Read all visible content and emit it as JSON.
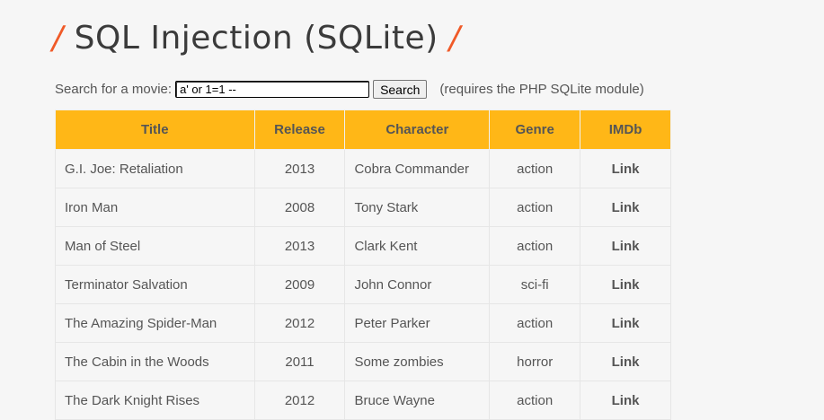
{
  "page": {
    "title": "SQL Injection (SQLite)",
    "slash": "/"
  },
  "search": {
    "label": "Search for a movie:",
    "value": "a' or 1=1 --",
    "button": "Search",
    "note": "(requires the PHP SQLite module)"
  },
  "table": {
    "headers": [
      "Title",
      "Release",
      "Character",
      "Genre",
      "IMDb"
    ],
    "rows": [
      {
        "title": "G.I. Joe: Retaliation",
        "release": "2013",
        "character": "Cobra Commander",
        "genre": "action",
        "imdb": "Link"
      },
      {
        "title": "Iron Man",
        "release": "2008",
        "character": "Tony Stark",
        "genre": "action",
        "imdb": "Link"
      },
      {
        "title": "Man of Steel",
        "release": "2013",
        "character": "Clark Kent",
        "genre": "action",
        "imdb": "Link"
      },
      {
        "title": "Terminator Salvation",
        "release": "2009",
        "character": "John Connor",
        "genre": "sci-fi",
        "imdb": "Link"
      },
      {
        "title": "The Amazing Spider-Man",
        "release": "2012",
        "character": "Peter Parker",
        "genre": "action",
        "imdb": "Link"
      },
      {
        "title": "The Cabin in the Woods",
        "release": "2011",
        "character": "Some zombies",
        "genre": "horror",
        "imdb": "Link"
      },
      {
        "title": "The Dark Knight Rises",
        "release": "2012",
        "character": "Bruce Wayne",
        "genre": "action",
        "imdb": "Link"
      }
    ]
  },
  "colors": {
    "accent": "#ffb717",
    "slash": "#f05a28"
  }
}
